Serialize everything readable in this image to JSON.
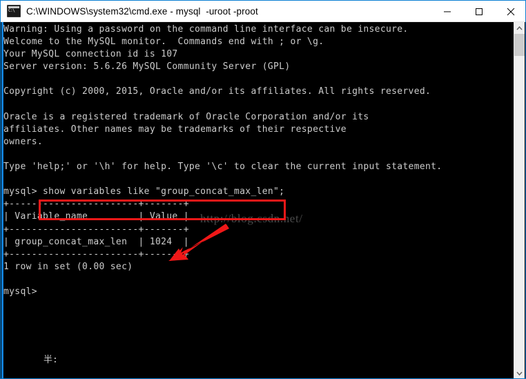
{
  "window": {
    "title": "C:\\WINDOWS\\system32\\cmd.exe - mysql  -uroot -proot",
    "icon": "cmd-console-icon",
    "controls": {
      "minimize_label": "minimize-icon",
      "maximize_label": "maximize-icon",
      "close_label": "close-icon"
    }
  },
  "console": {
    "foreground_color": "#cccccc",
    "background_color": "#000000",
    "text": "Warning: Using a password on the command line interface can be insecure.\nWelcome to the MySQL monitor.  Commands end with ; or \\g.\nYour MySQL connection id is 107\nServer version: 5.6.26 MySQL Community Server (GPL)\n\nCopyright (c) 2000, 2015, Oracle and/or its affiliates. All rights reserved.\n\nOracle is a registered trademark of Oracle Corporation and/or its\naffiliates. Other names may be trademarks of their respective\nowners.\n\nType 'help;' or '\\h' for help. Type '\\c' to clear the current input statement.\n\nmysql> show variables like \"group_concat_max_len\";\n+-----------------------+-------+\n| Variable_name         | Value |\n+-----------------------+-------+\n| group_concat_max_len  | 1024  |\n+-----------------------+-------+\n1 row in set (0.00 sec)\n\nmysql>",
    "lines": [
      "Warning: Using a password on the command line interface can be insecure.",
      "Welcome to the MySQL monitor.  Commands end with ; or \\g.",
      "Your MySQL connection id is 107",
      "Server version: 5.6.26 MySQL Community Server (GPL)",
      "",
      "Copyright (c) 2000, 2015, Oracle and/or its affiliates. All rights reserved.",
      "",
      "Oracle is a registered trademark of Oracle Corporation and/or its",
      "affiliates. Other names may be trademarks of their respective",
      "owners.",
      "",
      "Type 'help;' or '\\h' for help. Type '\\c' to clear the current input statement.",
      "",
      "mysql> show variables like \"group_concat_max_len\";",
      "+-----------------------+-------+",
      "| Variable_name         | Value |",
      "+-----------------------+-------+",
      "| group_concat_max_len  | 1024  |",
      "+-----------------------+-------+",
      "1 row in set (0.00 sec)",
      "",
      "mysql>"
    ],
    "prompt": "mysql>",
    "command": "show variables like \"group_concat_max_len\";",
    "result_table": {
      "headers": [
        "Variable_name",
        "Value"
      ],
      "rows": [
        [
          "group_concat_max_len",
          "1024"
        ]
      ],
      "footer": "1 row in set (0.00 sec)"
    },
    "ime_indicator": "半:"
  },
  "watermark": {
    "text": "http://blog.csdn.net/"
  },
  "annotations": {
    "color": "#f01818",
    "highlight_box_target": "show variables like \"group_concat_max_len\";",
    "arrow_target": "1024"
  },
  "scrollbar": {
    "up_arrow": "chevron-up-icon",
    "down_arrow": "chevron-down-icon",
    "thumb": "scroll-thumb"
  }
}
